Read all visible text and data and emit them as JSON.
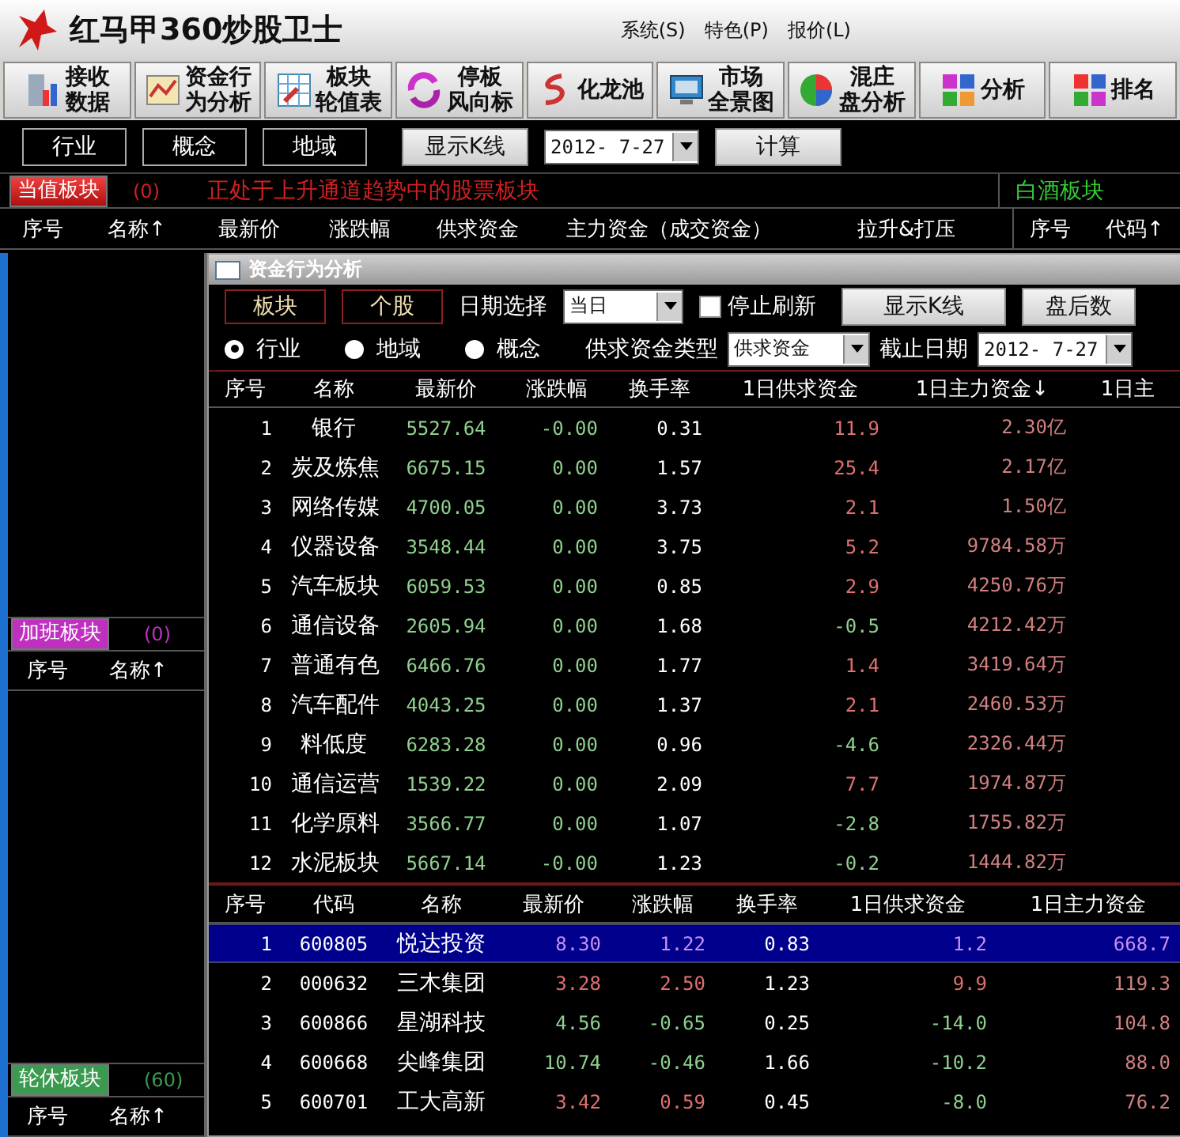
{
  "window": {
    "title": "红马甲360炒股卫士"
  },
  "menu": [
    "系统(S)",
    "特色(P)",
    "报价(L)"
  ],
  "toolbar": [
    {
      "lines": [
        "接收",
        "数据"
      ]
    },
    {
      "lines": [
        "资金行",
        "为分析"
      ]
    },
    {
      "lines": [
        "板块",
        "轮值表"
      ]
    },
    {
      "lines": [
        "停板",
        "风向标"
      ]
    },
    {
      "lines": [
        "化龙池"
      ]
    },
    {
      "lines": [
        "市场",
        "全景图"
      ]
    },
    {
      "lines": [
        "混庄",
        "盘分析"
      ]
    },
    {
      "lines": [
        "分析"
      ]
    },
    {
      "lines": [
        "排名"
      ]
    }
  ],
  "view_buttons": [
    "行业",
    "概念",
    "地域"
  ],
  "kline_button": "显示K线",
  "date": "2012- 7-27",
  "calc_button": "计算",
  "current_sector": {
    "tag": "当值板块",
    "count": "(0)",
    "note": "正处于上升通道趋势中的股票板块"
  },
  "main_columns": [
    "序号",
    "名称↑",
    "最新价",
    "涨跌幅",
    "供求资金",
    "主力资金（成交资金）",
    "拉升&打压"
  ],
  "right_panel": {
    "title": "白酒板块",
    "columns": [
      "序号",
      "代码↑"
    ]
  },
  "left_panels": [
    {
      "tag": "加班板块",
      "count": "(0)",
      "color": "#c030c0",
      "columns": [
        "序号",
        "名称↑"
      ]
    },
    {
      "tag": "轮休板块",
      "count": "(60)",
      "color": "#3a9a50",
      "columns": [
        "序号",
        "名称↑"
      ]
    }
  ],
  "dialog": {
    "title": "资金行为分析",
    "mode_buttons": [
      "板块",
      "个股"
    ],
    "date_label": "日期选择",
    "date_select": "当日",
    "stop_refresh": {
      "label": "停止刷新",
      "checked": false
    },
    "kline_button": "显示K线",
    "after_hours_button": "盘后数",
    "radios": [
      {
        "label": "行业",
        "selected": true
      },
      {
        "label": "地域",
        "selected": false
      },
      {
        "label": "概念",
        "selected": false
      }
    ],
    "fund_type_label": "供求资金类型",
    "fund_type_select": "供求资金",
    "end_date_label": "截止日期",
    "end_date": "2012- 7-27",
    "sector_table": {
      "columns": [
        "序号",
        "名称",
        "最新价",
        "涨跌幅",
        "换手率",
        "1日供求资金",
        "1日主力资金↓",
        "1日主"
      ],
      "rows": [
        {
          "no": "1",
          "name": "银行",
          "price": "5527.64",
          "change": "-0.00",
          "turnover": "0.31",
          "supply": "11.9",
          "supply_up": true,
          "main": "2.30亿"
        },
        {
          "no": "2",
          "name": "炭及炼焦",
          "price": "6675.15",
          "change": "0.00",
          "turnover": "1.57",
          "supply": "25.4",
          "supply_up": true,
          "main": "2.17亿"
        },
        {
          "no": "3",
          "name": "网络传媒",
          "price": "4700.05",
          "change": "0.00",
          "turnover": "3.73",
          "supply": "2.1",
          "supply_up": true,
          "main": "1.50亿"
        },
        {
          "no": "4",
          "name": "仪器设备",
          "price": "3548.44",
          "change": "0.00",
          "turnover": "3.75",
          "supply": "5.2",
          "supply_up": true,
          "main": "9784.58万"
        },
        {
          "no": "5",
          "name": "汽车板块",
          "price": "6059.53",
          "change": "0.00",
          "turnover": "0.85",
          "supply": "2.9",
          "supply_up": true,
          "main": "4250.76万"
        },
        {
          "no": "6",
          "name": "通信设备",
          "price": "2605.94",
          "change": "0.00",
          "turnover": "1.68",
          "supply": "-0.5",
          "supply_up": false,
          "main": "4212.42万"
        },
        {
          "no": "7",
          "name": "普通有色",
          "price": "6466.76",
          "change": "0.00",
          "turnover": "1.77",
          "supply": "1.4",
          "supply_up": true,
          "main": "3419.64万"
        },
        {
          "no": "8",
          "name": "汽车配件",
          "price": "4043.25",
          "change": "0.00",
          "turnover": "1.37",
          "supply": "2.1",
          "supply_up": true,
          "main": "2460.53万"
        },
        {
          "no": "9",
          "name": "料低度",
          "price": "6283.28",
          "change": "0.00",
          "turnover": "0.96",
          "supply": "-4.6",
          "supply_up": false,
          "main": "2326.44万"
        },
        {
          "no": "10",
          "name": "通信运营",
          "price": "1539.22",
          "change": "0.00",
          "turnover": "2.09",
          "supply": "7.7",
          "supply_up": true,
          "main": "1974.87万"
        },
        {
          "no": "11",
          "name": "化学原料",
          "price": "3566.77",
          "change": "0.00",
          "turnover": "1.07",
          "supply": "-2.8",
          "supply_up": false,
          "main": "1755.82万"
        },
        {
          "no": "12",
          "name": "水泥板块",
          "price": "5667.14",
          "change": "-0.00",
          "turnover": "1.23",
          "supply": "-0.2",
          "supply_up": false,
          "main": "1444.82万"
        }
      ]
    },
    "stock_table": {
      "columns": [
        "序号",
        "代码",
        "名称",
        "最新价",
        "涨跌幅",
        "换手率",
        "1日供求资金",
        "1日主力资金"
      ],
      "rows": [
        {
          "no": "1",
          "code": "600805",
          "name": "悦达投资",
          "price": "8.30",
          "change": "1.22",
          "turnover": "0.83",
          "supply": "1.2",
          "main": "668.7",
          "up": true,
          "supply_up": true,
          "selected": true
        },
        {
          "no": "2",
          "code": "000632",
          "name": "三木集团",
          "price": "3.28",
          "change": "2.50",
          "turnover": "1.23",
          "supply": "9.9",
          "main": "119.3",
          "up": true,
          "supply_up": true,
          "selected": false
        },
        {
          "no": "3",
          "code": "600866",
          "name": "星湖科技",
          "price": "4.56",
          "change": "-0.65",
          "turnover": "0.25",
          "supply": "-14.0",
          "main": "104.8",
          "up": false,
          "supply_up": false,
          "selected": false
        },
        {
          "no": "4",
          "code": "600668",
          "name": "尖峰集团",
          "price": "10.74",
          "change": "-0.46",
          "turnover": "1.66",
          "supply": "-10.2",
          "main": "88.0",
          "up": false,
          "supply_up": false,
          "selected": false
        },
        {
          "no": "5",
          "code": "600701",
          "name": "工大高新",
          "price": "3.42",
          "change": "0.59",
          "turnover": "0.45",
          "supply": "-8.0",
          "main": "76.2",
          "up": true,
          "supply_up": false,
          "selected": false
        }
      ]
    }
  }
}
